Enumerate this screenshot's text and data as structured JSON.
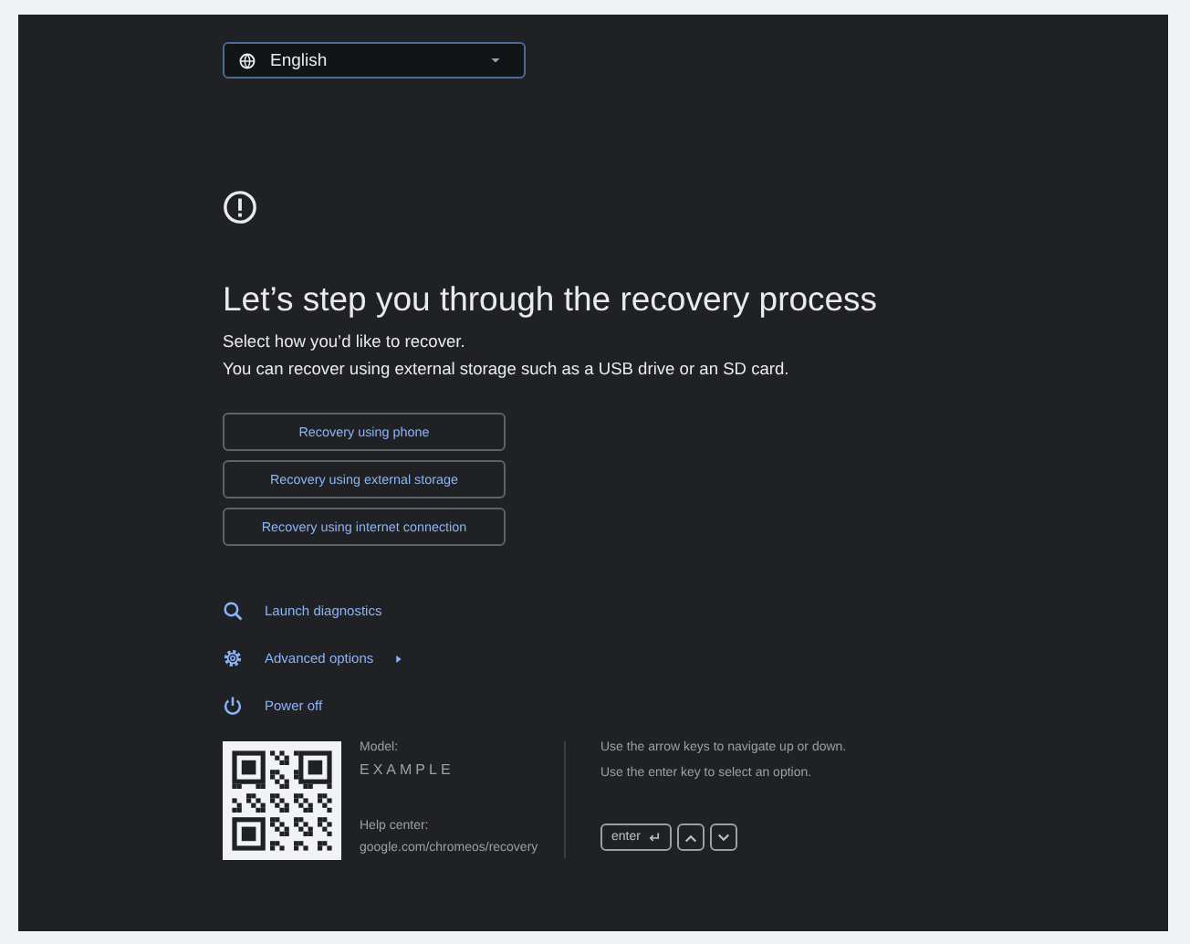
{
  "language_select": {
    "value": "English"
  },
  "title": "Let’s step you through the recovery process",
  "description": [
    "Select how you’d like to recover.",
    "You can recover using external storage such as a USB drive or an SD card."
  ],
  "options": [
    {
      "label": "Recovery using phone"
    },
    {
      "label": "Recovery using external storage"
    },
    {
      "label": "Recovery using internet connection"
    }
  ],
  "actions": [
    {
      "kind": "diagnostics",
      "label": "Launch diagnostics",
      "expandable": false
    },
    {
      "kind": "advanced",
      "label": "Advanced options",
      "expandable": true
    },
    {
      "kind": "power",
      "label": "Power off",
      "expandable": false
    }
  ],
  "info": {
    "model_label": "Model:",
    "model": "EXAMPLE",
    "help_label": "Help center:",
    "help_url": "google.com/chromeos/recovery"
  },
  "hints": [
    "Use the arrow keys to navigate up or down.",
    "Use the enter key to select an option."
  ],
  "keys": [
    {
      "kind": "enter",
      "label": "enter"
    },
    {
      "kind": "up"
    },
    {
      "kind": "down"
    }
  ]
}
